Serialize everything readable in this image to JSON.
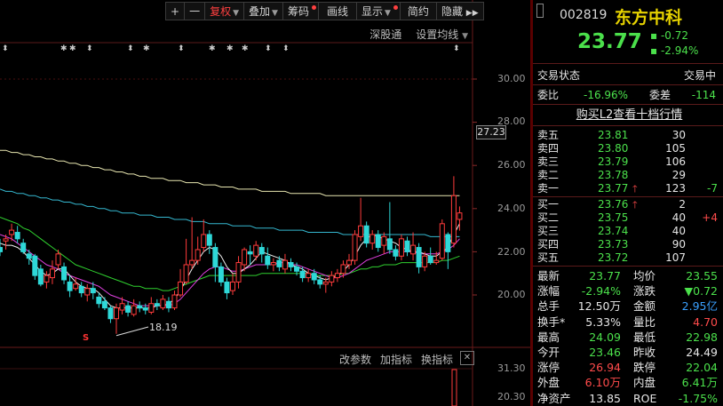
{
  "toolbar": {
    "plus": "+",
    "minus": "一",
    "fuquan": "复权",
    "diejia": "叠加",
    "chouma": "筹码",
    "huaxian": "画线",
    "xianshi": "显示",
    "jianyue": "简约",
    "yincang": "隐藏",
    "expand": "▶▶"
  },
  "subbar": {
    "market": "深股通",
    "ma_settings": "设置均线"
  },
  "axis": {
    "labels": [
      "30.00",
      "28.00",
      "26.00",
      "24.00",
      "22.00",
      "20.00"
    ],
    "current_price_tag": "27.23",
    "sub_labels": [
      "31.30",
      "20.30"
    ]
  },
  "indicator_bar": {
    "params": "改参数",
    "add": "加指标",
    "switch": "换指标",
    "close": "✕"
  },
  "annotations": {
    "low_price": "18.19",
    "s_mark": "S"
  },
  "chart_data": {
    "type": "candlestick",
    "title": "",
    "ylim": [
      17.5,
      31
    ],
    "candles": [
      [
        22.2,
        22.0,
        22.6,
        21.8
      ],
      [
        22.5,
        22.6,
        22.8,
        22.1
      ],
      [
        22.8,
        23.0,
        23.3,
        22.5
      ],
      [
        22.9,
        22.6,
        23.2,
        22.4
      ],
      [
        22.4,
        22.0,
        22.6,
        21.9
      ],
      [
        21.9,
        21.7,
        22.1,
        21.4
      ],
      [
        21.8,
        20.9,
        21.9,
        20.7
      ],
      [
        21.2,
        20.5,
        21.4,
        20.4
      ],
      [
        20.6,
        20.9,
        21.1,
        20.3
      ],
      [
        20.8,
        21.2,
        21.6,
        20.5
      ],
      [
        21.4,
        21.9,
        22.1,
        21.2
      ],
      [
        21.3,
        20.7,
        21.5,
        20.5
      ],
      [
        20.6,
        20.2,
        20.9,
        19.9
      ],
      [
        20.3,
        20.5,
        20.8,
        20.2
      ],
      [
        20.4,
        20.1,
        20.6,
        19.9
      ],
      [
        20.0,
        20.3,
        20.5,
        19.7
      ],
      [
        20.3,
        20.1,
        20.6,
        19.8
      ],
      [
        19.9,
        19.6,
        20.1,
        19.4
      ],
      [
        19.7,
        19.4,
        19.9,
        19.3
      ],
      [
        19.4,
        18.9,
        19.5,
        18.7
      ],
      [
        18.9,
        19.4,
        19.6,
        18.2
      ],
      [
        19.3,
        19.6,
        19.9,
        19.1
      ],
      [
        19.5,
        19.2,
        19.7,
        19.0
      ],
      [
        19.1,
        19.5,
        19.8,
        19.0
      ],
      [
        19.5,
        19.4,
        19.7,
        19.2
      ],
      [
        19.4,
        19.3,
        19.6,
        19.1
      ],
      [
        19.2,
        19.6,
        19.9,
        19.1
      ],
      [
        19.6,
        19.5,
        19.8,
        19.3
      ],
      [
        19.4,
        19.8,
        20.0,
        19.3
      ],
      [
        19.7,
        19.4,
        19.9,
        19.2
      ],
      [
        19.4,
        20.0,
        20.2,
        19.3
      ],
      [
        20.0,
        20.6,
        21.2,
        19.9
      ],
      [
        20.6,
        21.4,
        22.6,
        20.5
      ],
      [
        21.4,
        21.6,
        23.6,
        21.2
      ],
      [
        21.6,
        22.1,
        22.7,
        21.4
      ],
      [
        22.2,
        22.8,
        23.5,
        22.0
      ],
      [
        22.8,
        22.3,
        23.0,
        21.9
      ],
      [
        22.2,
        21.3,
        22.4,
        20.6
      ],
      [
        21.3,
        20.6,
        21.5,
        20.4
      ],
      [
        20.6,
        20.1,
        20.8,
        19.8
      ],
      [
        20.2,
        20.6,
        21.0,
        20.0
      ],
      [
        20.6,
        21.5,
        21.8,
        20.3
      ],
      [
        21.4,
        22.1,
        22.2,
        21.1
      ],
      [
        22.0,
        21.9,
        22.3,
        21.4
      ],
      [
        21.8,
        22.3,
        22.5,
        21.6
      ],
      [
        22.2,
        21.9,
        22.4,
        21.5
      ],
      [
        21.8,
        21.4,
        22.2,
        21.2
      ],
      [
        21.4,
        21.5,
        21.7,
        21.1
      ],
      [
        21.6,
        21.3,
        21.8,
        21.1
      ],
      [
        21.2,
        21.6,
        21.9,
        21.0
      ],
      [
        21.5,
        21.3,
        21.7,
        21.1
      ],
      [
        21.3,
        21.1,
        21.5,
        20.9
      ],
      [
        21.1,
        20.8,
        21.3,
        20.6
      ],
      [
        20.8,
        21.0,
        21.2,
        20.6
      ],
      [
        21.0,
        20.7,
        21.2,
        20.5
      ],
      [
        20.7,
        20.5,
        20.9,
        20.3
      ],
      [
        20.5,
        20.6,
        20.8,
        20.1
      ],
      [
        20.6,
        20.9,
        21.1,
        20.4
      ],
      [
        20.8,
        21.0,
        21.2,
        20.6
      ],
      [
        21.0,
        21.4,
        21.6,
        20.8
      ],
      [
        21.4,
        21.6,
        21.9,
        21.2
      ],
      [
        21.6,
        22.8,
        23.0,
        21.4
      ],
      [
        22.7,
        23.2,
        24.5,
        22.5
      ],
      [
        23.2,
        22.4,
        23.4,
        22.2
      ],
      [
        22.4,
        22.8,
        23.0,
        22.1
      ],
      [
        22.8,
        22.2,
        23.0,
        22.0
      ],
      [
        22.3,
        22.7,
        22.9,
        21.9
      ],
      [
        22.6,
        22.1,
        24.3,
        21.9
      ],
      [
        22.1,
        21.8,
        22.3,
        21.6
      ],
      [
        21.8,
        22.6,
        22.8,
        21.6
      ],
      [
        22.5,
        22.0,
        22.7,
        21.8
      ],
      [
        21.9,
        22.3,
        22.9,
        21.6
      ],
      [
        22.2,
        21.3,
        22.4,
        21.0
      ],
      [
        21.3,
        21.8,
        22.0,
        21.1
      ],
      [
        21.8,
        21.5,
        22.2,
        21.4
      ],
      [
        21.5,
        21.6,
        22.0,
        21.4
      ],
      [
        21.7,
        23.3,
        23.5,
        21.6
      ],
      [
        22.8,
        22.0,
        22.9,
        21.2
      ],
      [
        22.4,
        24.6,
        25.5,
        22.2
      ],
      [
        23.5,
        23.8,
        24.1,
        22.98
      ]
    ],
    "ma_long": [
      26.7,
      26.7,
      26.6,
      26.6,
      26.5,
      26.5,
      26.4,
      26.4,
      26.3,
      26.3,
      26.2,
      26.2,
      26.1,
      26.1,
      26.0,
      26.0,
      25.9,
      25.9,
      25.8,
      25.8,
      25.7,
      25.7,
      25.6,
      25.6,
      25.5,
      25.5,
      25.4,
      25.4,
      25.4,
      25.3,
      25.3,
      25.3,
      25.2,
      25.2,
      25.2,
      25.1,
      25.1,
      25.1,
      25.0,
      25.0,
      25.0,
      24.9,
      24.9,
      24.9,
      24.9,
      24.8,
      24.8,
      24.8,
      24.8,
      24.8,
      24.7,
      24.7,
      24.7,
      24.7,
      24.7,
      24.7,
      24.6,
      24.6,
      24.6,
      24.6,
      24.6,
      24.6,
      24.6,
      24.6,
      24.6,
      24.6,
      24.6,
      24.6,
      24.6,
      24.6,
      24.6,
      24.6,
      24.6,
      24.6,
      24.6,
      24.6,
      24.6,
      24.6,
      24.6,
      24.6
    ],
    "ma_mid": [
      24.9,
      24.8,
      24.8,
      24.7,
      24.7,
      24.6,
      24.6,
      24.5,
      24.5,
      24.4,
      24.4,
      24.3,
      24.3,
      24.2,
      24.2,
      24.1,
      24.1,
      24.0,
      24.0,
      23.9,
      23.9,
      23.8,
      23.8,
      23.8,
      23.7,
      23.7,
      23.7,
      23.6,
      23.6,
      23.6,
      23.5,
      23.5,
      23.5,
      23.4,
      23.4,
      23.4,
      23.3,
      23.3,
      23.3,
      23.3,
      23.2,
      23.2,
      23.2,
      23.2,
      23.1,
      23.1,
      23.1,
      23.1,
      23.0,
      23.0,
      23.0,
      23.0,
      23.0,
      22.9,
      22.9,
      22.9,
      22.9,
      22.9,
      22.9,
      22.8,
      22.8,
      22.8,
      22.8,
      22.8,
      22.8,
      22.8,
      22.8,
      22.8,
      22.8,
      22.8,
      22.8,
      22.8,
      22.8,
      22.8,
      22.7,
      22.7,
      22.7,
      22.7,
      22.7,
      22.7
    ],
    "ma20": [
      23.6,
      23.5,
      23.4,
      23.3,
      23.1,
      23.0,
      22.8,
      22.6,
      22.4,
      22.2,
      22.0,
      21.8,
      21.6,
      21.4,
      21.3,
      21.2,
      21.1,
      21.0,
      20.9,
      20.8,
      20.7,
      20.6,
      20.5,
      20.4,
      20.4,
      20.3,
      20.3,
      20.3,
      20.2,
      20.2,
      20.3,
      20.4,
      20.5,
      20.6,
      20.7,
      20.8,
      20.9,
      20.9,
      20.9,
      20.9,
      20.9,
      20.9,
      20.9,
      20.9,
      20.9,
      21.0,
      21.0,
      21.0,
      21.0,
      21.0,
      21.0,
      21.0,
      21.0,
      21.0,
      20.9,
      20.9,
      20.9,
      20.9,
      20.9,
      21.0,
      21.0,
      21.1,
      21.2,
      21.2,
      21.3,
      21.3,
      21.4,
      21.4,
      21.4,
      21.5,
      21.5,
      21.5,
      21.5,
      21.5,
      21.5,
      21.5,
      21.6,
      21.6,
      21.7,
      21.8
    ],
    "ma10": [
      22.8,
      22.7,
      22.6,
      22.4,
      22.2,
      22.0,
      21.8,
      21.6,
      21.4,
      21.3,
      21.2,
      21.0,
      20.9,
      20.8,
      20.7,
      20.6,
      20.5,
      20.4,
      20.2,
      20.0,
      19.9,
      19.8,
      19.7,
      19.6,
      19.5,
      19.5,
      19.5,
      19.5,
      19.5,
      19.5,
      19.6,
      19.8,
      20.1,
      20.4,
      20.7,
      21.0,
      21.2,
      21.3,
      21.3,
      21.2,
      21.1,
      21.1,
      21.2,
      21.3,
      21.4,
      21.4,
      21.4,
      21.4,
      21.5,
      21.5,
      21.4,
      21.4,
      21.3,
      21.2,
      21.1,
      21.0,
      20.9,
      20.8,
      20.8,
      20.9,
      21.0,
      21.2,
      21.4,
      21.6,
      21.7,
      21.8,
      21.9,
      22.0,
      22.0,
      22.0,
      22.0,
      22.0,
      21.9,
      21.9,
      21.9,
      21.9,
      22.0,
      22.1,
      22.3,
      22.6
    ],
    "ma5": [
      22.4,
      22.3,
      22.3,
      22.2,
      22.0,
      21.7,
      21.4,
      21.1,
      20.9,
      21.0,
      21.2,
      21.2,
      20.9,
      20.6,
      20.4,
      20.3,
      20.3,
      20.1,
      19.8,
      19.5,
      19.4,
      19.4,
      19.4,
      19.4,
      19.4,
      19.4,
      19.4,
      19.5,
      19.5,
      19.6,
      19.8,
      20.2,
      20.7,
      21.2,
      21.6,
      22.0,
      22.2,
      22.1,
      21.8,
      21.3,
      21.0,
      21.0,
      21.2,
      21.4,
      21.7,
      22.0,
      21.9,
      21.8,
      21.7,
      21.6,
      21.4,
      21.3,
      21.2,
      21.0,
      20.9,
      20.8,
      20.7,
      20.8,
      20.9,
      21.1,
      21.4,
      21.8,
      22.3,
      22.6,
      22.8,
      22.7,
      22.6,
      22.5,
      22.4,
      22.2,
      22.1,
      22.0,
      22.0,
      21.9,
      21.8,
      21.8,
      22.0,
      22.2,
      22.8,
      23.3
    ]
  },
  "panel": {
    "code": "002819",
    "name": "东方中科",
    "price": "23.77",
    "change": "-0.72",
    "change_pct": "-2.94%",
    "status_label": "交易状态",
    "status_value": "交易中",
    "weibi_label": "委比",
    "weibi_value": "-16.96%",
    "weicha_label": "委差",
    "weicha_value": "-114",
    "l2_link": "购买L2查看十档行情",
    "asks": [
      {
        "label": "卖五",
        "price": "23.81",
        "vol": "30",
        "chg": ""
      },
      {
        "label": "卖四",
        "price": "23.80",
        "vol": "105",
        "chg": ""
      },
      {
        "label": "卖三",
        "price": "23.79",
        "vol": "106",
        "chg": ""
      },
      {
        "label": "卖二",
        "price": "23.78",
        "vol": "29",
        "chg": ""
      },
      {
        "label": "卖一",
        "price": "23.77",
        "vol": "123",
        "chg": "-7"
      }
    ],
    "bids": [
      {
        "label": "买一",
        "price": "23.76",
        "vol": "2",
        "chg": ""
      },
      {
        "label": "买二",
        "price": "23.75",
        "vol": "40",
        "chg": "+4"
      },
      {
        "label": "买三",
        "price": "23.74",
        "vol": "40",
        "chg": ""
      },
      {
        "label": "买四",
        "price": "23.73",
        "vol": "90",
        "chg": ""
      },
      {
        "label": "买五",
        "price": "23.72",
        "vol": "107",
        "chg": ""
      }
    ],
    "stats": [
      {
        "l1": "最新",
        "v1": "23.77",
        "l2": "均价",
        "v2": "23.55"
      },
      {
        "l1": "涨幅",
        "v1": "-2.94%",
        "l2": "涨跌",
        "v2": "▼0.72"
      },
      {
        "l1": "总手",
        "v1": "12.50万",
        "l2": "金额",
        "v2": "2.95亿"
      },
      {
        "l1": "换手*",
        "v1": "5.33%",
        "l2": "量比",
        "v2": "4.70"
      },
      {
        "l1": "最高",
        "v1": "24.09",
        "l2": "最低",
        "v2": "22.98"
      },
      {
        "l1": "今开",
        "v1": "23.46",
        "l2": "昨收",
        "v2": "24.49"
      },
      {
        "l1": "涨停",
        "v1": "26.94",
        "l2": "跌停",
        "v2": "22.04"
      },
      {
        "l1": "外盘",
        "v1": "6.10万",
        "l2": "内盘",
        "v2": "6.41万"
      },
      {
        "l1": "净资产",
        "v1": "13.85",
        "l2": "ROE",
        "v2": "-1.75%"
      }
    ]
  }
}
